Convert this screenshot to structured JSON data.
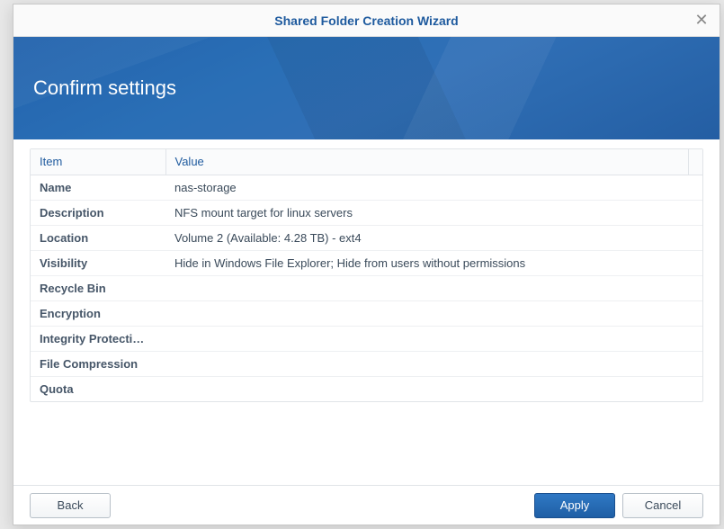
{
  "dialog": {
    "title": "Shared Folder Creation Wizard",
    "banner_title": "Confirm settings"
  },
  "table": {
    "headers": {
      "item": "Item",
      "value": "Value"
    },
    "rows": [
      {
        "item": "Name",
        "value": "nas-storage"
      },
      {
        "item": "Description",
        "value": "NFS mount target for linux servers"
      },
      {
        "item": "Location",
        "value": "Volume 2 (Available: 4.28 TB) - ext4"
      },
      {
        "item": "Visibility",
        "value": "Hide in Windows File Explorer; Hide from users without permissions"
      },
      {
        "item": "Recycle Bin",
        "value": ""
      },
      {
        "item": "Encryption",
        "value": ""
      },
      {
        "item": "Integrity Protecti…",
        "value": ""
      },
      {
        "item": "File Compression",
        "value": ""
      },
      {
        "item": "Quota",
        "value": ""
      }
    ]
  },
  "buttons": {
    "back": "Back",
    "apply": "Apply",
    "cancel": "Cancel"
  }
}
